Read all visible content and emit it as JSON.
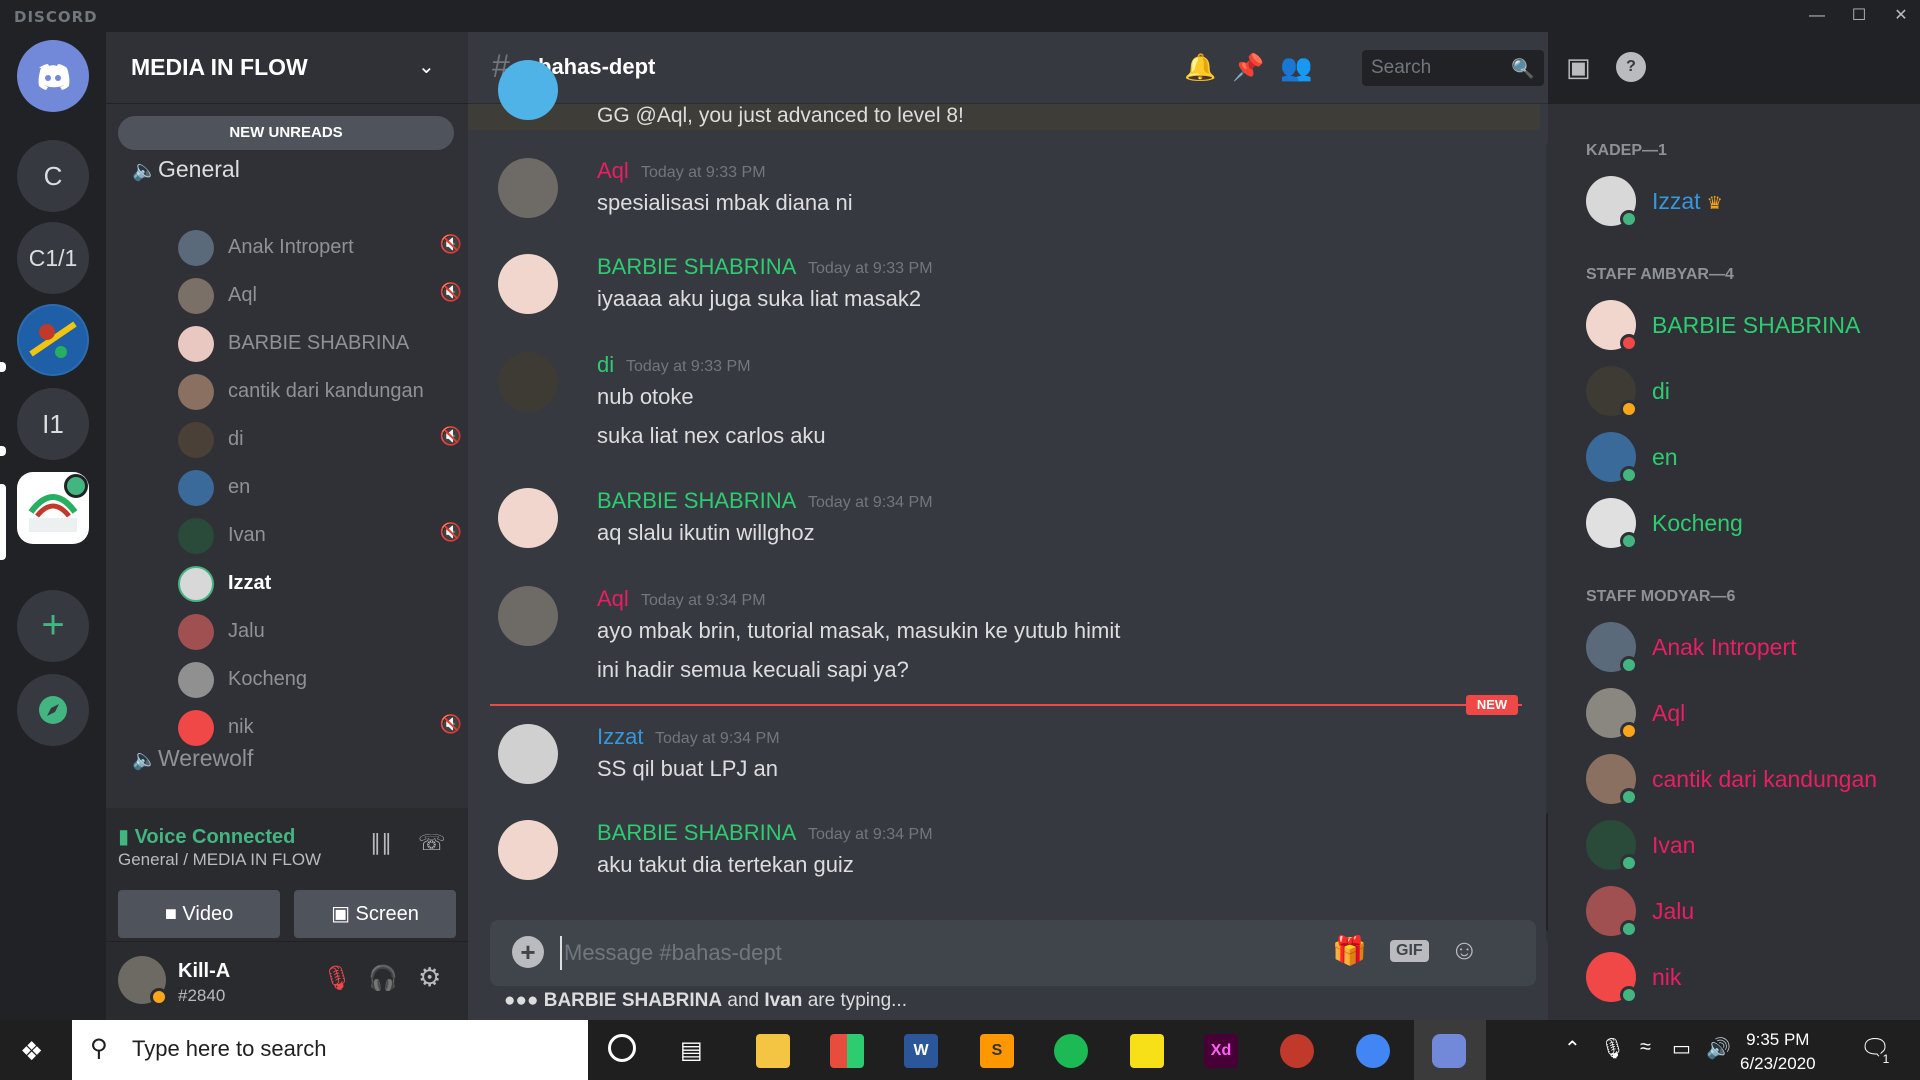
{
  "app": {
    "brand": "DISCORD"
  },
  "servers": [
    {
      "label": "C"
    },
    {
      "label": "C1/1"
    },
    {
      "label": "I1"
    }
  ],
  "guild": {
    "name": "MEDIA IN FLOW",
    "new_unreads": "NEW UNREADS"
  },
  "voice_channels": [
    {
      "name": "General"
    },
    {
      "name": "Werewolf"
    }
  ],
  "voice_users": [
    {
      "name": "Anak Intropert",
      "muted": true
    },
    {
      "name": "Aql",
      "muted": true
    },
    {
      "name": "BARBIE SHABRINA",
      "muted": false
    },
    {
      "name": "cantik dari kandungan",
      "muted": false
    },
    {
      "name": "di",
      "muted": true
    },
    {
      "name": "en",
      "muted": false
    },
    {
      "name": "Ivan",
      "muted": true
    },
    {
      "name": "Izzat",
      "muted": false
    },
    {
      "name": "Jalu",
      "muted": false
    },
    {
      "name": "Kocheng",
      "muted": false
    },
    {
      "name": "nik",
      "muted": true
    }
  ],
  "voice_panel": {
    "status": "Voice Connected",
    "location": "General / MEDIA IN FLOW",
    "video_label": "Video",
    "screen_label": "Screen"
  },
  "user": {
    "name": "Kill-A",
    "tag": "#2840"
  },
  "channel": {
    "name": "bahas-dept",
    "search_placeholder": "Search"
  },
  "messages": [
    {
      "lines": [
        "GG @Aql, you just advanced to level 8!"
      ]
    },
    {
      "author": "Aql",
      "color": "#e91e63",
      "time": "Today at 9:33 PM",
      "lines": [
        "spesialisasi mbak diana ni"
      ]
    },
    {
      "author": "BARBIE SHABRINA",
      "color": "#2ecc71",
      "time": "Today at 9:33 PM",
      "lines": [
        "iyaaaa aku juga suka liat masak2"
      ]
    },
    {
      "author": "di",
      "color": "#2ecc71",
      "time": "Today at 9:33 PM",
      "lines": [
        "nub otoke",
        "suka liat nex carlos aku"
      ]
    },
    {
      "author": "BARBIE SHABRINA",
      "color": "#2ecc71",
      "time": "Today at 9:34 PM",
      "lines": [
        "aq slalu ikutin willghoz"
      ]
    },
    {
      "author": "Aql",
      "color": "#e91e63",
      "time": "Today at 9:34 PM",
      "lines": [
        "ayo mbak brin, tutorial masak, masukin ke yutub himit",
        "ini hadir semua kecuali sapi ya?"
      ]
    },
    {
      "author": "Izzat",
      "color": "#3498db",
      "time": "Today at 9:34 PM",
      "lines": [
        "SS qil buat LPJ an"
      ]
    },
    {
      "author": "BARBIE SHABRINA",
      "color": "#2ecc71",
      "time": "Today at 9:34 PM",
      "lines": [
        "aku takut dia tertekan guiz"
      ]
    }
  ],
  "new_divider": "NEW",
  "composer": {
    "placeholder": "Message #bahas-dept",
    "gif": "GIF"
  },
  "typing": {
    "user1": "BARBIE SHABRINA",
    "and": "and",
    "user2": "Ivan",
    "suffix": "are typing..."
  },
  "member_groups": [
    {
      "title": "KADEP—1",
      "members": [
        {
          "name": "Izzat",
          "color": "#3498db",
          "status": "#43b581",
          "crown": "♛"
        }
      ]
    },
    {
      "title": "STAFF AMBYAR—4",
      "members": [
        {
          "name": "BARBIE SHABRINA",
          "color": "#2ecc71",
          "status": "#f04747"
        },
        {
          "name": "di",
          "color": "#2ecc71",
          "status": "#faa61a"
        },
        {
          "name": "en",
          "color": "#2ecc71",
          "status": "#43b581"
        },
        {
          "name": "Kocheng",
          "color": "#2ecc71",
          "status": "#43b581"
        }
      ]
    },
    {
      "title": "STAFF MODYAR—6",
      "members": [
        {
          "name": "Anak Intropert",
          "color": "#e91e63",
          "status": "#43b581"
        },
        {
          "name": "Aql",
          "color": "#e91e63",
          "status": "#faa61a"
        },
        {
          "name": "cantik dari kandungan",
          "color": "#e91e63",
          "status": "#43b581"
        },
        {
          "name": "Ivan",
          "color": "#e91e63",
          "status": "#43b581"
        },
        {
          "name": "Jalu",
          "color": "#e91e63",
          "status": "#43b581"
        },
        {
          "name": "nik",
          "color": "#e91e63",
          "status": "#43b581"
        }
      ]
    }
  ],
  "taskbar": {
    "search_placeholder": "Type here to search",
    "time": "9:35 PM",
    "date": "6/23/2020",
    "notif_count": "1"
  },
  "colors": {
    "accent": "#7289da",
    "online": "#43b581",
    "idle": "#faa61a",
    "dnd": "#f04747"
  }
}
